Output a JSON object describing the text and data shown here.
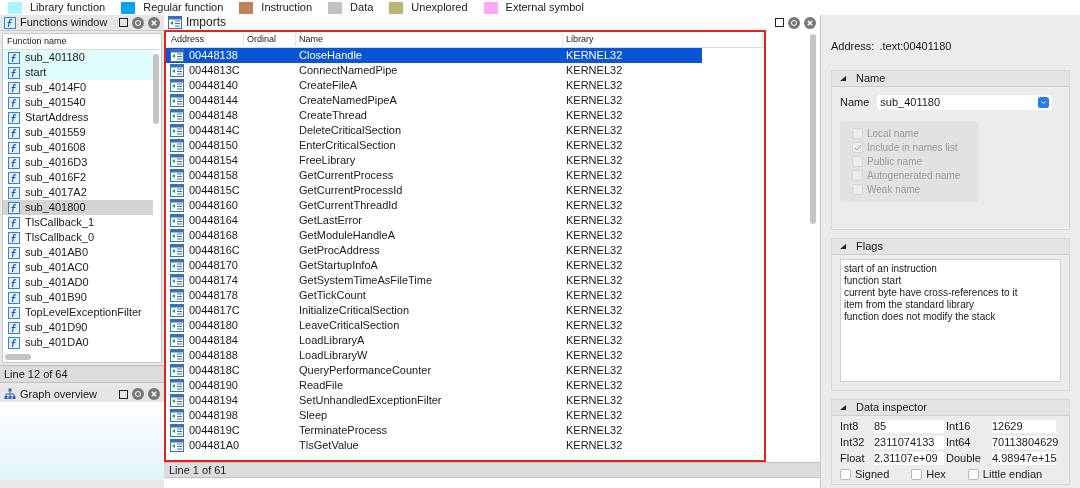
{
  "legend": [
    {
      "label": "Library function",
      "color": "#a8f4ff"
    },
    {
      "label": "Regular function",
      "color": "#00a6ee"
    },
    {
      "label": "Instruction",
      "color": "#c0825e"
    },
    {
      "label": "Data",
      "color": "#c2c2c2"
    },
    {
      "label": "Unexplored",
      "color": "#b9b66f"
    },
    {
      "label": "External symbol",
      "color": "#ffa6f7"
    }
  ],
  "functions_window": {
    "title": "Functions window",
    "column": "Function name",
    "status": "Line 12 of 64",
    "rows": [
      {
        "name": "sub_401180",
        "kind": "library",
        "selected": false
      },
      {
        "name": "start",
        "kind": "library",
        "selected": false
      },
      {
        "name": "sub_4014F0",
        "kind": "regular",
        "selected": false
      },
      {
        "name": "sub_401540",
        "kind": "regular",
        "selected": false
      },
      {
        "name": "StartAddress",
        "kind": "regular",
        "selected": false
      },
      {
        "name": "sub_401559",
        "kind": "regular",
        "selected": false
      },
      {
        "name": "sub_401608",
        "kind": "regular",
        "selected": false
      },
      {
        "name": "sub_4016D3",
        "kind": "regular",
        "selected": false
      },
      {
        "name": "sub_4016F2",
        "kind": "regular",
        "selected": false
      },
      {
        "name": "sub_4017A2",
        "kind": "regular",
        "selected": false
      },
      {
        "name": "sub_401800",
        "kind": "regular",
        "selected": true
      },
      {
        "name": "TlsCallback_1",
        "kind": "regular",
        "selected": false
      },
      {
        "name": "TlsCallback_0",
        "kind": "regular",
        "selected": false
      },
      {
        "name": "sub_401AB0",
        "kind": "regular",
        "selected": false
      },
      {
        "name": "sub_401AC0",
        "kind": "regular",
        "selected": false
      },
      {
        "name": "sub_401AD0",
        "kind": "regular",
        "selected": false
      },
      {
        "name": "sub_401B90",
        "kind": "regular",
        "selected": false
      },
      {
        "name": "TopLevelExceptionFilter",
        "kind": "regular",
        "selected": false
      },
      {
        "name": "sub_401D90",
        "kind": "regular",
        "selected": false
      },
      {
        "name": "sub_401DA0",
        "kind": "regular",
        "selected": false
      }
    ]
  },
  "graph_overview": {
    "title": "Graph overview"
  },
  "imports": {
    "title": "Imports",
    "columns": [
      "Address",
      "Ordinal",
      "Name",
      "Library"
    ],
    "status": "Line 1 of 61",
    "rows": [
      {
        "address": "00448138",
        "name": "CloseHandle",
        "library": "KERNEL32",
        "selected": true
      },
      {
        "address": "0044813C",
        "name": "ConnectNamedPipe",
        "library": "KERNEL32",
        "selected": false
      },
      {
        "address": "00448140",
        "name": "CreateFileA",
        "library": "KERNEL32",
        "selected": false
      },
      {
        "address": "00448144",
        "name": "CreateNamedPipeA",
        "library": "KERNEL32",
        "selected": false
      },
      {
        "address": "00448148",
        "name": "CreateThread",
        "library": "KERNEL32",
        "selected": false
      },
      {
        "address": "0044814C",
        "name": "DeleteCriticalSection",
        "library": "KERNEL32",
        "selected": false
      },
      {
        "address": "00448150",
        "name": "EnterCriticalSection",
        "library": "KERNEL32",
        "selected": false
      },
      {
        "address": "00448154",
        "name": "FreeLibrary",
        "library": "KERNEL32",
        "selected": false
      },
      {
        "address": "00448158",
        "name": "GetCurrentProcess",
        "library": "KERNEL32",
        "selected": false
      },
      {
        "address": "0044815C",
        "name": "GetCurrentProcessId",
        "library": "KERNEL32",
        "selected": false
      },
      {
        "address": "00448160",
        "name": "GetCurrentThreadId",
        "library": "KERNEL32",
        "selected": false
      },
      {
        "address": "00448164",
        "name": "GetLastError",
        "library": "KERNEL32",
        "selected": false
      },
      {
        "address": "00448168",
        "name": "GetModuleHandleA",
        "library": "KERNEL32",
        "selected": false
      },
      {
        "address": "0044816C",
        "name": "GetProcAddress",
        "library": "KERNEL32",
        "selected": false
      },
      {
        "address": "00448170",
        "name": "GetStartupInfoA",
        "library": "KERNEL32",
        "selected": false
      },
      {
        "address": "00448174",
        "name": "GetSystemTimeAsFileTime",
        "library": "KERNEL32",
        "selected": false
      },
      {
        "address": "00448178",
        "name": "GetTickCount",
        "library": "KERNEL32",
        "selected": false
      },
      {
        "address": "0044817C",
        "name": "InitializeCriticalSection",
        "library": "KERNEL32",
        "selected": false
      },
      {
        "address": "00448180",
        "name": "LeaveCriticalSection",
        "library": "KERNEL32",
        "selected": false
      },
      {
        "address": "00448184",
        "name": "LoadLibraryA",
        "library": "KERNEL32",
        "selected": false
      },
      {
        "address": "00448188",
        "name": "LoadLibraryW",
        "library": "KERNEL32",
        "selected": false
      },
      {
        "address": "0044818C",
        "name": "QueryPerformanceCounter",
        "library": "KERNEL32",
        "selected": false
      },
      {
        "address": "00448190",
        "name": "ReadFile",
        "library": "KERNEL32",
        "selected": false
      },
      {
        "address": "00448194",
        "name": "SetUnhandledExceptionFilter",
        "library": "KERNEL32",
        "selected": false
      },
      {
        "address": "00448198",
        "name": "Sleep",
        "library": "KERNEL32",
        "selected": false
      },
      {
        "address": "0044819C",
        "name": "TerminateProcess",
        "library": "KERNEL32",
        "selected": false
      },
      {
        "address": "004481A0",
        "name": "TlsGetValue",
        "library": "KERNEL32",
        "selected": false
      }
    ]
  },
  "inspector": {
    "address_label": "Address:",
    "address": ".text:00401180",
    "name_section": {
      "title": "Name",
      "field_label": "Name",
      "value": "sub_401180",
      "options": [
        {
          "label": "Local name",
          "checked": false
        },
        {
          "label": "Include in names list",
          "checked": true
        },
        {
          "label": "Public name",
          "checked": false
        },
        {
          "label": "Autogenerated name",
          "checked": false
        },
        {
          "label": "Weak name",
          "checked": false
        }
      ]
    },
    "flags": {
      "title": "Flags",
      "lines": [
        "start of an instruction",
        "function start",
        "current byte have cross-references to it",
        "item from the standard library",
        "function does not modify the stack"
      ]
    },
    "data_inspector": {
      "title": "Data inspector",
      "fields": [
        {
          "label": "Int8",
          "value": "85"
        },
        {
          "label": "Int16",
          "value": "12629"
        },
        {
          "label": "Int32",
          "value": "2311074133"
        },
        {
          "label": "Int64",
          "value": "70113804629"
        },
        {
          "label": "Float",
          "value": "2.31107e+09"
        },
        {
          "label": "Double",
          "value": "4.98947e+15"
        }
      ],
      "options": [
        {
          "label": "Signed",
          "checked": false
        },
        {
          "label": "Hex",
          "checked": false
        },
        {
          "label": "Little endian",
          "checked": false
        }
      ]
    }
  }
}
